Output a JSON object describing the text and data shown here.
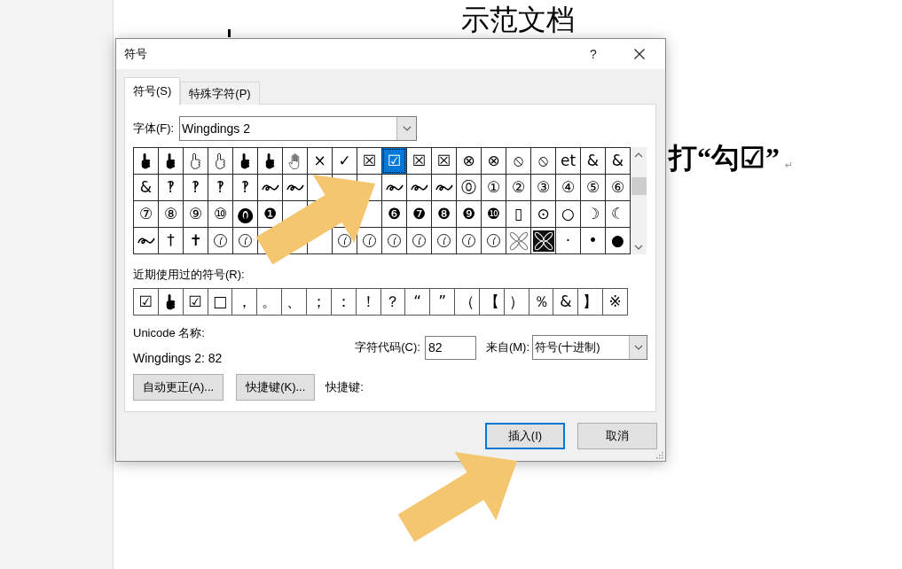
{
  "document": {
    "heading": "示范文档",
    "body_text": "打“勾☑”",
    "paragraph_mark": "↵"
  },
  "dialog": {
    "title": "符号",
    "help_button": "?",
    "tabs": [
      {
        "label": "符号(S)",
        "selected": true
      },
      {
        "label": "特殊字符(P)",
        "selected": false
      }
    ],
    "font_field": {
      "label": "字体(F):",
      "value": "Wingdings 2"
    },
    "symbol_grid": {
      "rows": [
        [
          {
            "kind": "hand",
            "selected": false
          },
          {
            "kind": "hand",
            "selected": false
          },
          {
            "kind": "hollowhand",
            "selected": false
          },
          {
            "kind": "hollowhand",
            "selected": false
          },
          {
            "kind": "hand",
            "selected": false
          },
          {
            "kind": "hand",
            "selected": false
          },
          {
            "kind": "palm",
            "selected": false
          },
          {
            "kind": "char",
            "text": "×",
            "selected": false
          },
          {
            "kind": "char",
            "text": "✓",
            "selected": false
          },
          {
            "kind": "char",
            "text": "☒",
            "selected": false
          },
          {
            "kind": "char",
            "text": "☑",
            "selected": true
          },
          {
            "kind": "char",
            "text": "☒",
            "selected": false
          },
          {
            "kind": "char",
            "text": "☒",
            "selected": false
          },
          {
            "kind": "char",
            "text": "⊗",
            "selected": false
          },
          {
            "kind": "char",
            "text": "⊗",
            "selected": false
          },
          {
            "kind": "char",
            "text": "⦸",
            "selected": false
          },
          {
            "kind": "char",
            "text": "⦸",
            "selected": false
          },
          {
            "kind": "char",
            "text": "et",
            "selected": false
          },
          {
            "kind": "char",
            "text": "&",
            "selected": false
          },
          {
            "kind": "char",
            "text": "&",
            "selected": false
          }
        ],
        [
          {
            "kind": "char",
            "text": "&",
            "selected": false
          },
          {
            "kind": "char",
            "text": "‽",
            "selected": false
          },
          {
            "kind": "char",
            "text": "‽",
            "selected": false
          },
          {
            "kind": "char",
            "text": "‽",
            "selected": false
          },
          {
            "kind": "char",
            "text": "‽",
            "selected": false
          },
          {
            "kind": "ornament",
            "selected": false
          },
          {
            "kind": "ornament",
            "selected": false
          },
          {
            "kind": "hidden",
            "selected": false
          },
          {
            "kind": "hidden",
            "selected": false
          },
          {
            "kind": "hidden",
            "selected": false
          },
          {
            "kind": "ornament",
            "selected": false
          },
          {
            "kind": "ornament",
            "selected": false
          },
          {
            "kind": "ornament",
            "selected": false
          },
          {
            "kind": "char",
            "text": "⓪",
            "selected": false
          },
          {
            "kind": "char",
            "text": "①",
            "selected": false
          },
          {
            "kind": "char",
            "text": "②",
            "selected": false
          },
          {
            "kind": "char",
            "text": "③",
            "selected": false
          },
          {
            "kind": "char",
            "text": "④",
            "selected": false
          },
          {
            "kind": "char",
            "text": "⑤",
            "selected": false
          },
          {
            "kind": "char",
            "text": "⑥",
            "selected": false
          }
        ],
        [
          {
            "kind": "char",
            "text": "⑦",
            "selected": false
          },
          {
            "kind": "char",
            "text": "⑧",
            "selected": false
          },
          {
            "kind": "char",
            "text": "⑨",
            "selected": false
          },
          {
            "kind": "char",
            "text": "⑩",
            "selected": false
          },
          {
            "kind": "char",
            "text": "⓿",
            "selected": false
          },
          {
            "kind": "char",
            "text": "❶",
            "selected": false
          },
          {
            "kind": "hidden",
            "selected": false
          },
          {
            "kind": "hidden",
            "selected": false
          },
          {
            "kind": "hidden",
            "selected": false
          },
          {
            "kind": "hidden",
            "selected": false
          },
          {
            "kind": "char",
            "text": "❻",
            "selected": false
          },
          {
            "kind": "char",
            "text": "❼",
            "selected": false
          },
          {
            "kind": "char",
            "text": "❽",
            "selected": false
          },
          {
            "kind": "char",
            "text": "❾",
            "selected": false
          },
          {
            "kind": "char",
            "text": "❿",
            "selected": false
          },
          {
            "kind": "char",
            "text": "▯",
            "selected": false
          },
          {
            "kind": "char",
            "text": "⊙",
            "selected": false
          },
          {
            "kind": "char",
            "text": "○",
            "selected": false
          },
          {
            "kind": "char",
            "text": "☽",
            "selected": false
          },
          {
            "kind": "char",
            "text": "☾",
            "selected": false
          }
        ],
        [
          {
            "kind": "ornament",
            "selected": false
          },
          {
            "kind": "char",
            "text": "†",
            "selected": false
          },
          {
            "kind": "char",
            "text": "✝",
            "selected": false
          },
          {
            "kind": "clock",
            "selected": false
          },
          {
            "kind": "clock",
            "selected": false
          },
          {
            "kind": "hidden",
            "selected": false
          },
          {
            "kind": "hidden",
            "selected": false
          },
          {
            "kind": "hidden",
            "selected": false
          },
          {
            "kind": "clock",
            "selected": false
          },
          {
            "kind": "clock",
            "selected": false
          },
          {
            "kind": "clock",
            "selected": false
          },
          {
            "kind": "clock",
            "selected": false
          },
          {
            "kind": "clock",
            "selected": false
          },
          {
            "kind": "clock",
            "selected": false
          },
          {
            "kind": "clock",
            "selected": false
          },
          {
            "kind": "flower",
            "selected": false
          },
          {
            "kind": "tile",
            "selected": false
          },
          {
            "kind": "char",
            "text": "·",
            "selected": false
          },
          {
            "kind": "char",
            "text": "•",
            "selected": false
          },
          {
            "kind": "char",
            "text": "●",
            "selected": false
          }
        ]
      ]
    },
    "recent_symbols": {
      "label": "近期使用过的符号(R):",
      "cells": [
        {
          "kind": "char",
          "text": "☑",
          "selected": false
        },
        {
          "kind": "hand",
          "selected": false
        },
        {
          "kind": "char",
          "text": "☑",
          "selected": false
        },
        {
          "kind": "char",
          "text": "□",
          "selected": false
        },
        {
          "kind": "char",
          "text": "，",
          "selected": false
        },
        {
          "kind": "char",
          "text": "。",
          "selected": false
        },
        {
          "kind": "char",
          "text": "、",
          "selected": false
        },
        {
          "kind": "char",
          "text": "；",
          "selected": false
        },
        {
          "kind": "char",
          "text": "：",
          "selected": false
        },
        {
          "kind": "char",
          "text": "！",
          "selected": false
        },
        {
          "kind": "char",
          "text": "？",
          "selected": false
        },
        {
          "kind": "char",
          "text": "“",
          "selected": false
        },
        {
          "kind": "char",
          "text": "”",
          "selected": false
        },
        {
          "kind": "char",
          "text": "（",
          "selected": false
        },
        {
          "kind": "char",
          "text": "【",
          "selected": false
        },
        {
          "kind": "char",
          "text": "）",
          "selected": false
        },
        {
          "kind": "char",
          "text": "％",
          "selected": false
        },
        {
          "kind": "char",
          "text": "&",
          "selected": false
        },
        {
          "kind": "char",
          "text": "】",
          "selected": false
        },
        {
          "kind": "char",
          "text": "※",
          "selected": false
        }
      ]
    },
    "unicode_name": {
      "label": "Unicode 名称:",
      "value": "Wingdings 2: 82"
    },
    "character_code": {
      "label": "字符代码(C):",
      "value": "82"
    },
    "from_field": {
      "label": "来自(M):",
      "value": "符号(十进制)"
    },
    "buttons": [
      {
        "label": "自动更正(A)..."
      },
      {
        "label": "快捷键(K)..."
      }
    ],
    "shortcut_label": "快捷键:",
    "actions": [
      {
        "label": "插入(I)",
        "default": true
      },
      {
        "label": "取消",
        "default": false
      }
    ]
  },
  "annotations": [
    {
      "kind": "arrow"
    },
    {
      "kind": "arrow"
    }
  ]
}
